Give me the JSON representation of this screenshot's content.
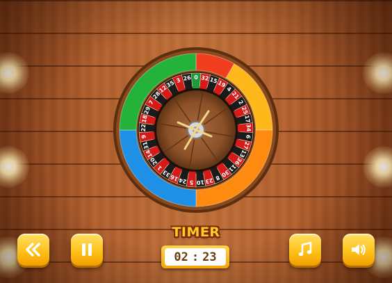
{
  "timer": {
    "label": "TIMER",
    "minutes": "02",
    "separator": ":",
    "seconds": "23"
  },
  "controls": {
    "back": "back-icon",
    "pause": "pause-icon",
    "music": "music-icon",
    "sound": "speaker-icon"
  },
  "wheel": {
    "pockets": [
      "0",
      "32",
      "15",
      "19",
      "4",
      "21",
      "2",
      "25",
      "17",
      "34",
      "6",
      "27",
      "13",
      "36",
      "11",
      "30",
      "8",
      "23",
      "10",
      "5",
      "24",
      "16",
      "33",
      "1",
      "20",
      "14",
      "31",
      "9",
      "22",
      "18",
      "29",
      "7",
      "28",
      "12",
      "35",
      "3",
      "26"
    ],
    "segments": [
      "red",
      "yellow",
      "orange",
      "blue",
      "green"
    ],
    "colors": {
      "red": "#f03e1e",
      "yellow": "#ffb81a",
      "orange": "#ff8a10",
      "blue": "#1e90e6",
      "green": "#24b33a",
      "pocket_red": "#d61a1a",
      "pocket_black": "#1a1a1a",
      "pocket_green": "#1d9a3a"
    }
  }
}
